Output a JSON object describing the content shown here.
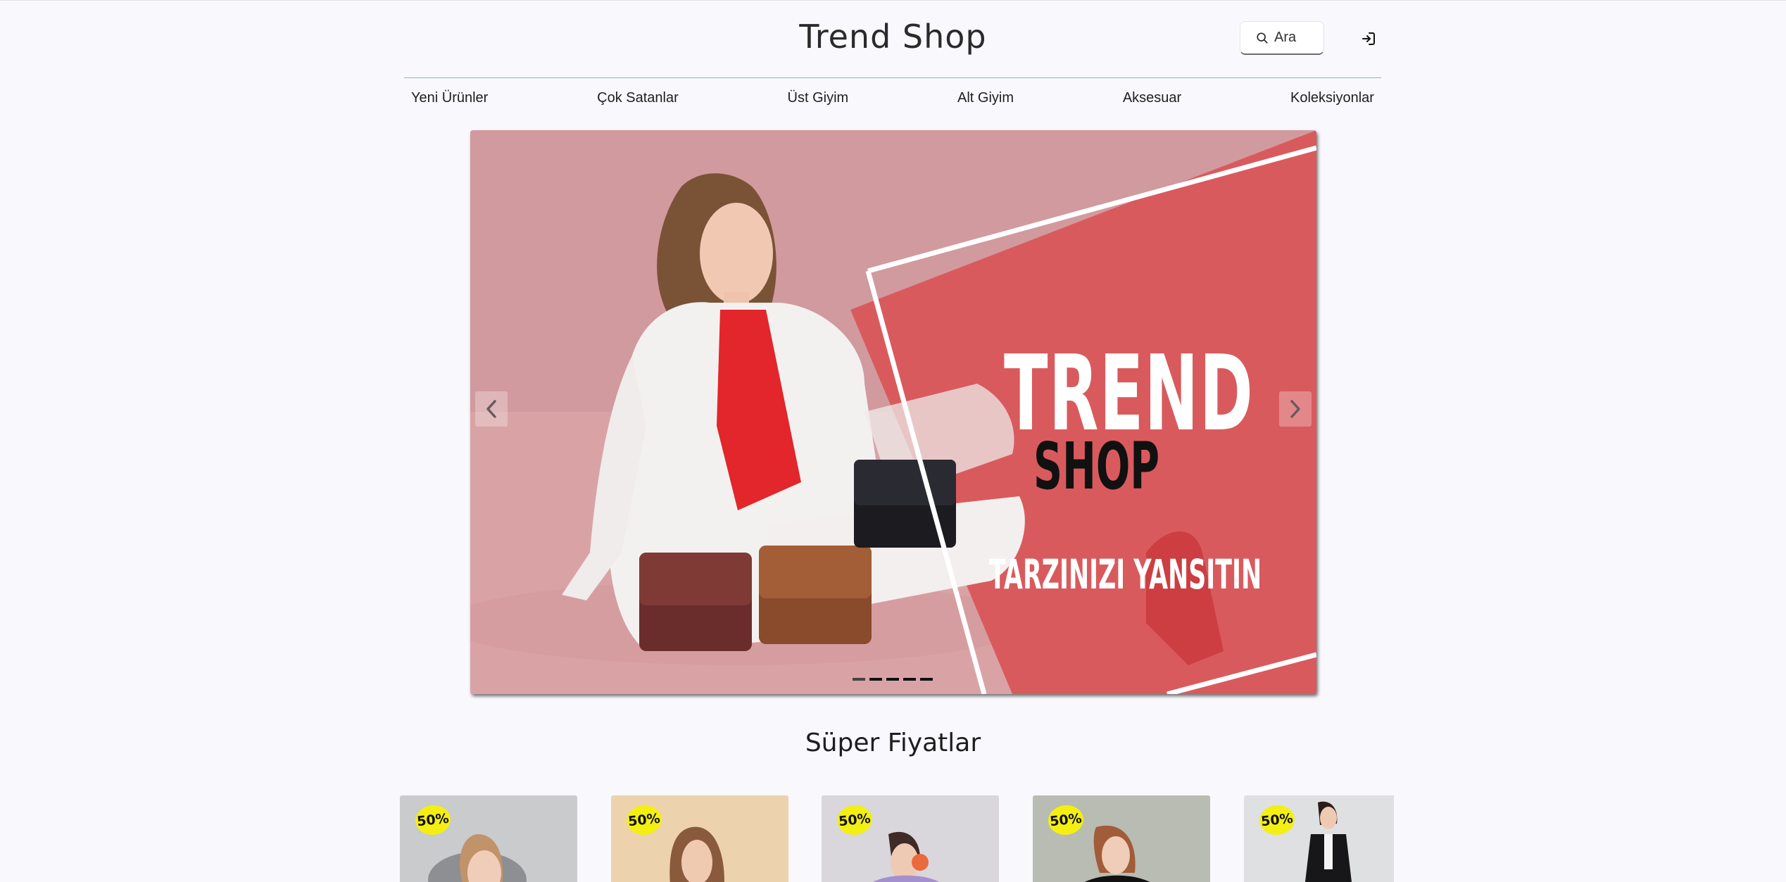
{
  "header": {
    "title": "Trend Shop",
    "search_placeholder": "Ara"
  },
  "nav": {
    "items": [
      {
        "label": "Yeni Ürünler"
      },
      {
        "label": "Çok Satanlar"
      },
      {
        "label": "Üst Giyim"
      },
      {
        "label": "Alt Giyim"
      },
      {
        "label": "Aksesuar"
      },
      {
        "label": "Koleksiyonlar"
      }
    ]
  },
  "hero": {
    "title": "TREND",
    "subtitle": "SHOP",
    "tagline": "TARZINIZI YANSITIN",
    "slide_count": 5,
    "active_slide": 1
  },
  "section": {
    "title": "Süper Fiyatlar"
  },
  "products": [
    {
      "discount": "50%"
    },
    {
      "discount": "50%"
    },
    {
      "discount": "50%"
    },
    {
      "discount": "50%"
    },
    {
      "discount": "50%"
    }
  ],
  "icons": {
    "search": "search-icon",
    "login": "login-icon",
    "prev": "chevron-left-icon",
    "next": "chevron-right-icon"
  },
  "colors": {
    "background": "#f9f8fd",
    "hero_red": "#d95a5d",
    "hero_pink": "#d9a3a6",
    "badge_yellow": "#f4ef12",
    "nav_line": "#8fb7b0"
  }
}
